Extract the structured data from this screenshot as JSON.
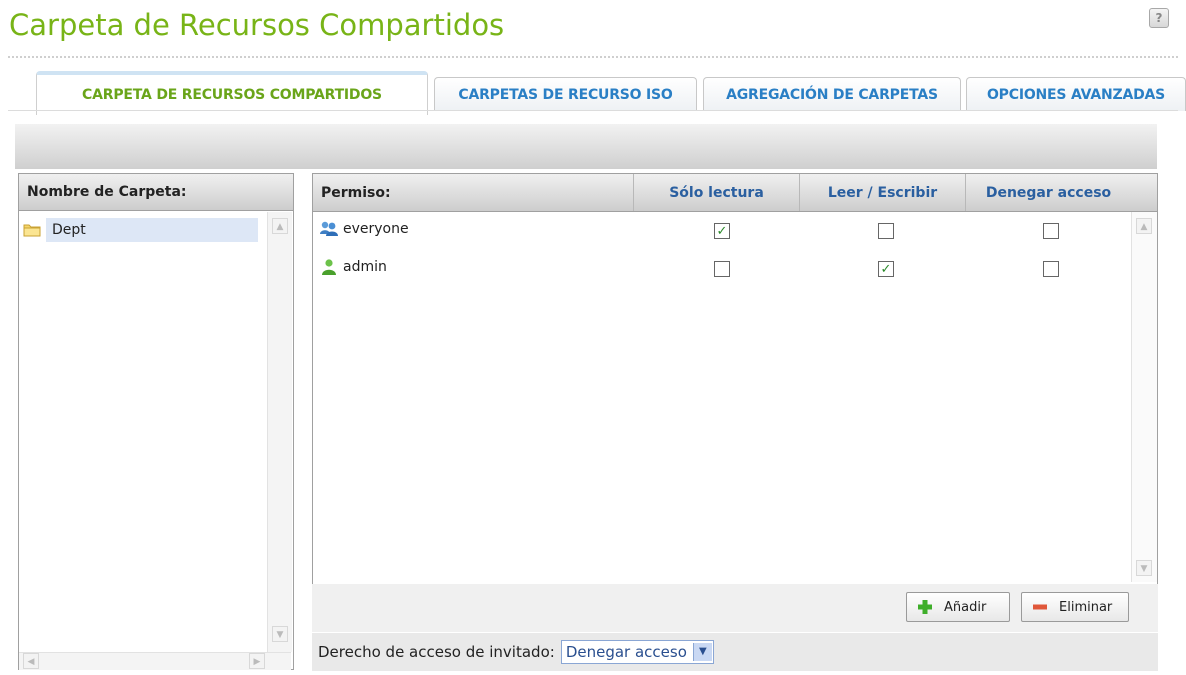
{
  "header": {
    "title": "Carpeta de Recursos Compartidos",
    "help_glyph": "?"
  },
  "tabs": [
    {
      "label": "CARPETA DE RECURSOS COMPARTIDOS",
      "active": true
    },
    {
      "label": "CARPETAS DE RECURSO ISO",
      "active": false
    },
    {
      "label": "AGREGACIÓN DE CARPETAS",
      "active": false
    },
    {
      "label": "OPCIONES AVANZADAS",
      "active": false
    }
  ],
  "folders": {
    "header": "Nombre de Carpeta:",
    "items": [
      {
        "label": "Dept",
        "icon": "folder-icon",
        "selected": true
      }
    ]
  },
  "permissions": {
    "columns": {
      "name": "Permiso:",
      "read_only": "Sólo lectura",
      "read_write": "Leer / Escribir",
      "deny": "Denegar acceso"
    },
    "rows": [
      {
        "name": "everyone",
        "icon": "group-icon",
        "read_only": true,
        "read_write": false,
        "deny": false
      },
      {
        "name": "admin",
        "icon": "user-icon",
        "read_only": false,
        "read_write": true,
        "deny": false
      }
    ]
  },
  "buttons": {
    "add": "Añadir",
    "remove": "Eliminar"
  },
  "guest_access": {
    "label": "Derecho de acceso de invitado:",
    "value": "Denegar acceso"
  },
  "colors": {
    "title_green": "#78b417",
    "tab_blue": "#2a7fc5",
    "tab_active_green": "#6aa51a",
    "header_blue": "#2a5fa0",
    "check_green": "#2a8a2a"
  }
}
